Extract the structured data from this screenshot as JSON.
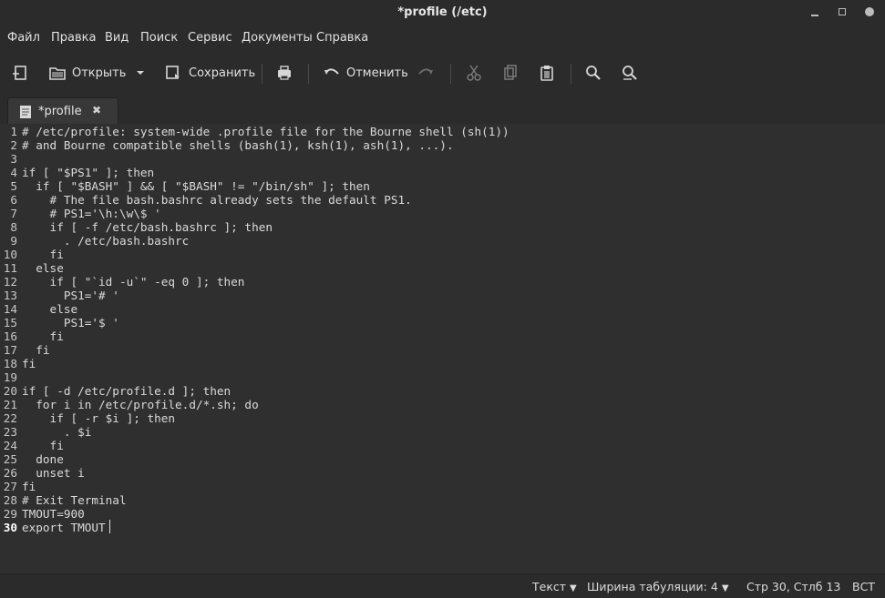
{
  "window": {
    "title": "*profile (/etc)"
  },
  "menu": [
    "Файл",
    "Правка",
    "Вид",
    "Поиск",
    "Сервис",
    "Документы",
    "Справка"
  ],
  "toolbar": {
    "open_label": "Открыть",
    "save_label": "Сохранить",
    "undo_label": "Отменить"
  },
  "tab": {
    "label": "*profile",
    "close_glyph": "✖"
  },
  "editor": {
    "current_line": 30,
    "lines": [
      "# /etc/profile: system-wide .profile file for the Bourne shell (sh(1))",
      "# and Bourne compatible shells (bash(1), ksh(1), ash(1), ...).",
      "",
      "if [ \"$PS1\" ]; then",
      "  if [ \"$BASH\" ] && [ \"$BASH\" != \"/bin/sh\" ]; then",
      "    # The file bash.bashrc already sets the default PS1.",
      "    # PS1='\\h:\\w\\$ '",
      "    if [ -f /etc/bash.bashrc ]; then",
      "      . /etc/bash.bashrc",
      "    fi",
      "  else",
      "    if [ \"`id -u`\" -eq 0 ]; then",
      "      PS1='# '",
      "    else",
      "      PS1='$ '",
      "    fi",
      "  fi",
      "fi",
      "",
      "if [ -d /etc/profile.d ]; then",
      "  for i in /etc/profile.d/*.sh; do",
      "    if [ -r $i ]; then",
      "      . $i",
      "    fi",
      "  done",
      "  unset i",
      "fi",
      "# Exit Terminal",
      "TMOUT=900",
      "export TMOUT"
    ]
  },
  "status": {
    "syntax": "Текст",
    "tab_width": "Ширина табуляции: 4",
    "position": "Стр 30, Стлб 13",
    "insert_mode": "ВСТ"
  }
}
